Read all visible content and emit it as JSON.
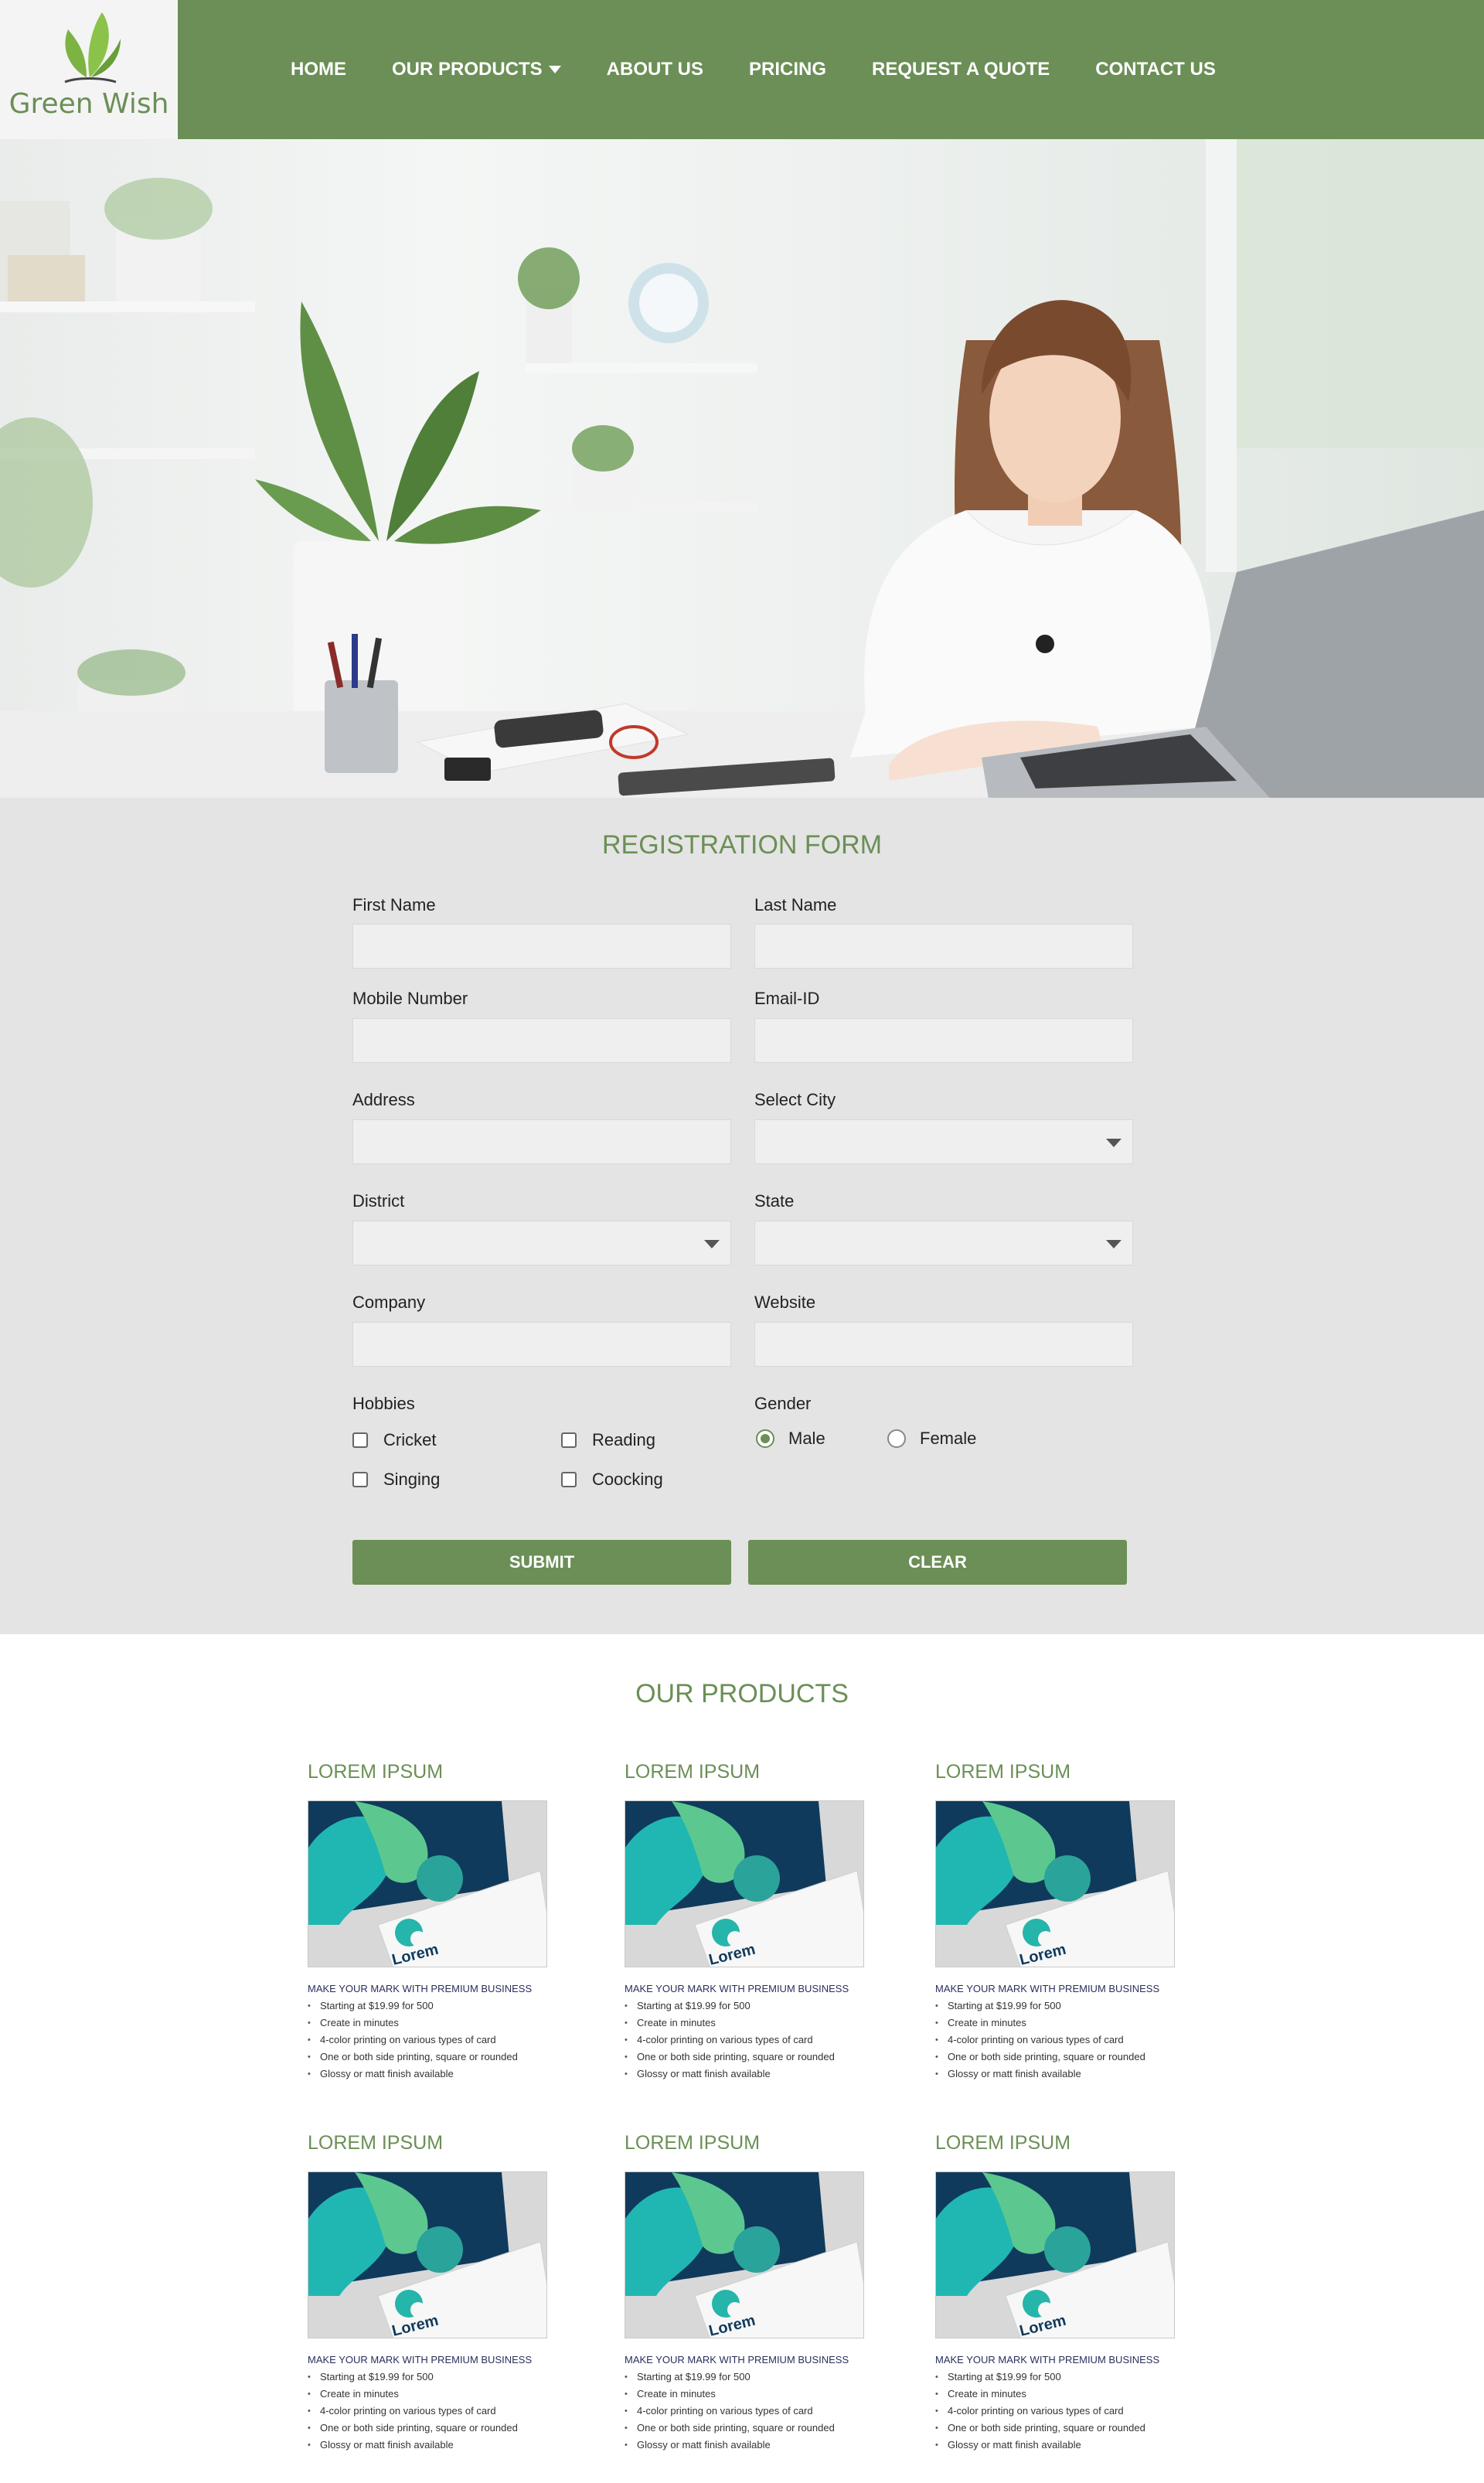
{
  "brand": {
    "name": "Green Wish",
    "color": "#6b8f56"
  },
  "nav": {
    "items": [
      {
        "label": "HOME"
      },
      {
        "label": "OUR PRODUCTS",
        "dropdown": true
      },
      {
        "label": "ABOUT US"
      },
      {
        "label": "PRICING"
      },
      {
        "label": "REQUEST A QUOTE"
      },
      {
        "label": "CONTACT US"
      }
    ]
  },
  "form": {
    "title": "REGISTRATION FORM",
    "first_name": "First Name",
    "last_name": "Last Name",
    "mobile": "Mobile Number",
    "email": "Email-ID",
    "address": "Address",
    "city": "Select City",
    "district": "District",
    "state": "State",
    "company": "Company",
    "website": "Website",
    "hobbies_label": "Hobbies",
    "hobbies": [
      "Cricket",
      "Reading",
      "Singing",
      "Coocking"
    ],
    "gender_label": "Gender",
    "genders": [
      {
        "label": "Male",
        "checked": true
      },
      {
        "label": "Female",
        "checked": false
      }
    ],
    "submit": "SUBMIT",
    "clear": "CLEAR"
  },
  "products": {
    "title": "OUR PRODUCTS",
    "items": [
      {
        "title": "LOREM IPSUM",
        "headline": "MAKE YOUR MARK WITH PREMIUM BUSINESS",
        "features": [
          "Starting at $19.99 for 500",
          "Create in minutes",
          "4-color printing on various types of card",
          "One or both side printing, square or rounded",
          "Glossy or matt finish available"
        ]
      },
      {
        "title": "LOREM IPSUM",
        "headline": "MAKE YOUR MARK WITH PREMIUM BUSINESS",
        "features": [
          "Starting at $19.99 for 500",
          "Create in minutes",
          "4-color printing on various types of card",
          "One or both side printing, square or rounded",
          "Glossy or matt finish available"
        ]
      },
      {
        "title": "LOREM IPSUM",
        "headline": "MAKE YOUR MARK WITH PREMIUM BUSINESS",
        "features": [
          "Starting at $19.99 for 500",
          "Create in minutes",
          "4-color printing on various types of card",
          "One or both side printing, square or rounded",
          "Glossy or matt finish available"
        ]
      },
      {
        "title": "LOREM IPSUM",
        "headline": "MAKE YOUR MARK WITH PREMIUM BUSINESS",
        "features": [
          "Starting at $19.99 for 500",
          "Create in minutes",
          "4-color printing on various types of card",
          "One or both side printing, square or rounded",
          "Glossy or matt finish available"
        ]
      },
      {
        "title": "LOREM IPSUM",
        "headline": "MAKE YOUR MARK WITH PREMIUM BUSINESS",
        "features": [
          "Starting at $19.99 for 500",
          "Create in minutes",
          "4-color printing on various types of card",
          "One or both side printing, square or rounded",
          "Glossy or matt finish available"
        ]
      },
      {
        "title": "LOREM IPSUM",
        "headline": "MAKE YOUR MARK WITH PREMIUM BUSINESS",
        "features": [
          "Starting at $19.99 for 500",
          "Create in minutes",
          "4-color printing on various types of card",
          "One or both side printing, square or rounded",
          "Glossy or matt finish available"
        ]
      }
    ]
  }
}
